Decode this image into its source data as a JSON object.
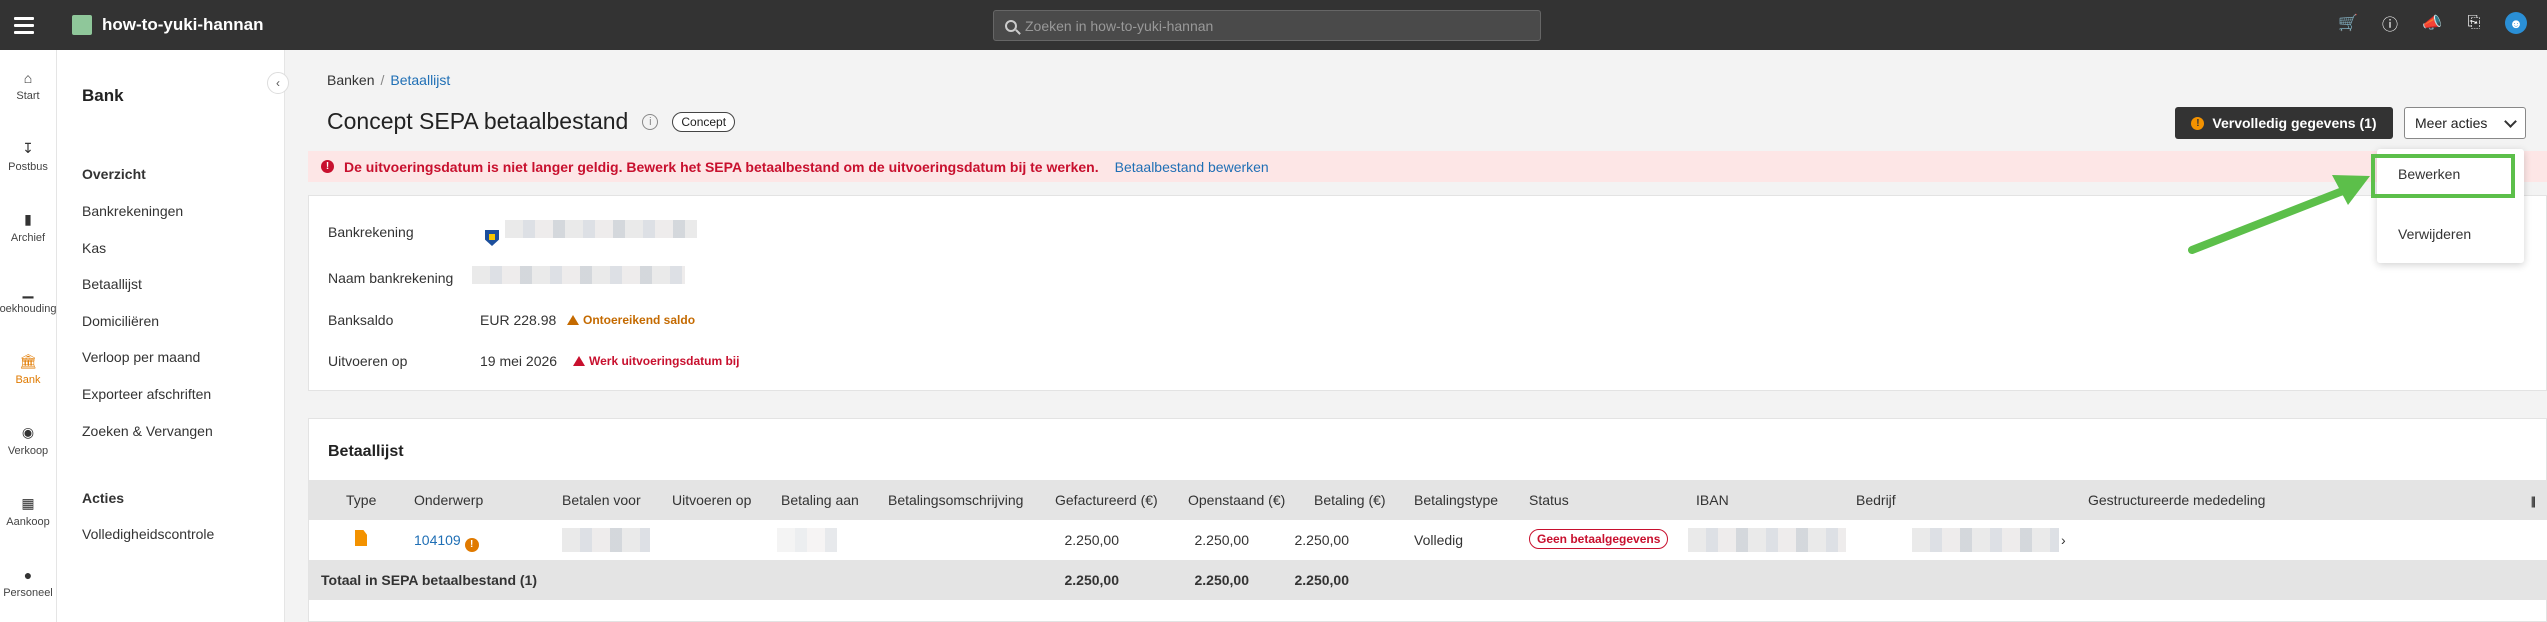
{
  "topbar": {
    "title": "how-to-yuki-hannan",
    "search_placeholder": "Zoeken in how-to-yuki-hannan",
    "icons": [
      "menu-icon",
      "cart-icon",
      "info-icon",
      "megaphone-icon",
      "bookmark-icon",
      "user-icon"
    ]
  },
  "rail": {
    "items": [
      {
        "label": "Start",
        "icon": "home-icon"
      },
      {
        "label": "Postbus",
        "icon": "inbox-icon"
      },
      {
        "label": "Archief",
        "icon": "archive-icon"
      },
      {
        "label": "oekhouding",
        "icon": "chart-icon"
      },
      {
        "label": "Bank",
        "icon": "bank-icon"
      },
      {
        "label": "Verkoop",
        "icon": "chat-icon"
      },
      {
        "label": "Aankoop",
        "icon": "truck-icon"
      },
      {
        "label": "Personeel",
        "icon": "people-icon"
      }
    ]
  },
  "sidebar": {
    "title": "Bank",
    "section1": "Overzicht",
    "items": [
      "Bankrekeningen",
      "Kas",
      "Betaallijst",
      "Domiciliëren",
      "Verloop per maand",
      "Exporteer afschriften",
      "Zoeken & Vervangen"
    ],
    "section2": "Acties",
    "actions": [
      "Volledigheidscontrole"
    ]
  },
  "breadcrumb": {
    "root": "Banken",
    "current": "Betaallijst"
  },
  "page": {
    "title": "Concept SEPA betaalbestand",
    "badge": "Concept",
    "btn_complete": "Vervolledig gegevens (1)",
    "btn_more": "Meer acties"
  },
  "alert": {
    "message": "De uitvoeringsdatum is niet langer geldig. Bewerk het SEPA betaalbestand om de uitvoeringsdatum bij te werken.",
    "link": "Betaalbestand bewerken"
  },
  "details": {
    "bankrekening_label": "Bankrekening",
    "naam_label": "Naam bankrekening",
    "saldo_label": "Banksaldo",
    "saldo_value": "EUR 228.98",
    "saldo_warning": "Ontoereikend saldo",
    "uitvoeren_label": "Uitvoeren op",
    "uitvoeren_value": "19 mei 2026",
    "uitvoeren_warning": "Werk uitvoeringsdatum bij"
  },
  "table": {
    "title": "Betaallijst",
    "columns": [
      "Type",
      "Onderwerp",
      "Betalen voor",
      "Uitvoeren op",
      "Betaling aan",
      "Betalingsomschrijving",
      "Gefactureerd (€)",
      "Openstaand (€)",
      "Betaling (€)",
      "Betalingstype",
      "Status",
      "IBAN",
      "Bedrijf",
      "Gestructureerde mededeling"
    ],
    "row": {
      "onderwerp": "104109",
      "gefactureerd": "2.250,00",
      "openstaand": "2.250,00",
      "betaling": "2.250,00",
      "betalingstype": "Volledig",
      "status": "Geen betaalgegevens",
      "mededeling_fragment": "›"
    },
    "footer": {
      "label": "Totaal in SEPA betaalbestand (1)",
      "gefactureerd": "2.250,00",
      "openstaand": "2.250,00",
      "betaling": "2.250,00"
    }
  },
  "dropdown": {
    "items": [
      "Bewerken",
      "Verwijderen"
    ]
  },
  "colors": {
    "accent": "#e07a00",
    "error": "#c8102e",
    "link": "#1f6fb5",
    "highlight": "#5cbf4a"
  }
}
